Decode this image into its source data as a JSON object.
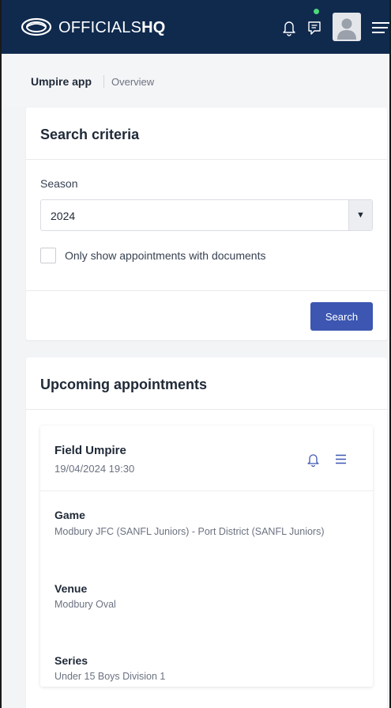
{
  "header": {
    "brand_prefix": "OFFICIALS",
    "brand_suffix": "HQ",
    "logo_icon": "logo-icon",
    "notification_icon": "bell-icon",
    "messages_icon": "chat-icon",
    "menu_icon": "menu-icon"
  },
  "breadcrumb": {
    "app": "Umpire app",
    "page": "Overview"
  },
  "search_card": {
    "title": "Search criteria",
    "season_label": "Season",
    "season_value": "2024",
    "documents_label": "Only show appointments with documents",
    "search_label": "Search"
  },
  "upcoming_card": {
    "title": "Upcoming appointments",
    "appointment": {
      "role": "Field Umpire",
      "datetime": "19/04/2024 19:30",
      "game_label": "Game",
      "game_value": "Modbury JFC (SANFL Juniors) - Port District (SANFL Juniors)",
      "venue_label": "Venue",
      "venue_value": "Modbury Oval",
      "series_label": "Series",
      "series_value": "Under 15 Boys Division 1"
    }
  },
  "colors": {
    "header_bg": "#102a4e",
    "accent": "#3d56b2",
    "status_dot": "#4cd97b"
  }
}
